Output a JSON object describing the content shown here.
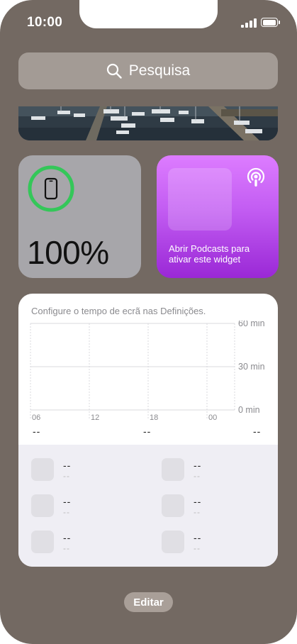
{
  "status_bar": {
    "time": "10:00",
    "battery_level": 1.0
  },
  "search": {
    "label": "Pesquisa",
    "icon": "search-icon"
  },
  "battery_widget": {
    "percent": "100%",
    "ring_level": 1.0,
    "ring_color": "#34c759",
    "icon": "iphone-icon"
  },
  "podcasts_widget": {
    "message": "Abrir Podcasts para ativar este widget",
    "icon": "podcasts-icon"
  },
  "screen_time": {
    "title": "Configure o tempo de ecrã nas Definições.",
    "chart": {
      "y_labels": [
        "60 min",
        "30 min",
        "0 min"
      ],
      "x_labels": [
        "06",
        "12",
        "18",
        "00"
      ]
    },
    "summary": [
      "--",
      "--",
      "--"
    ],
    "apps": [
      {
        "name": "--",
        "time": "--"
      },
      {
        "name": "--",
        "time": "--"
      },
      {
        "name": "--",
        "time": "--"
      },
      {
        "name": "--",
        "time": "--"
      },
      {
        "name": "--",
        "time": "--"
      },
      {
        "name": "--",
        "time": "--"
      }
    ]
  },
  "edit_button": {
    "label": "Editar"
  }
}
